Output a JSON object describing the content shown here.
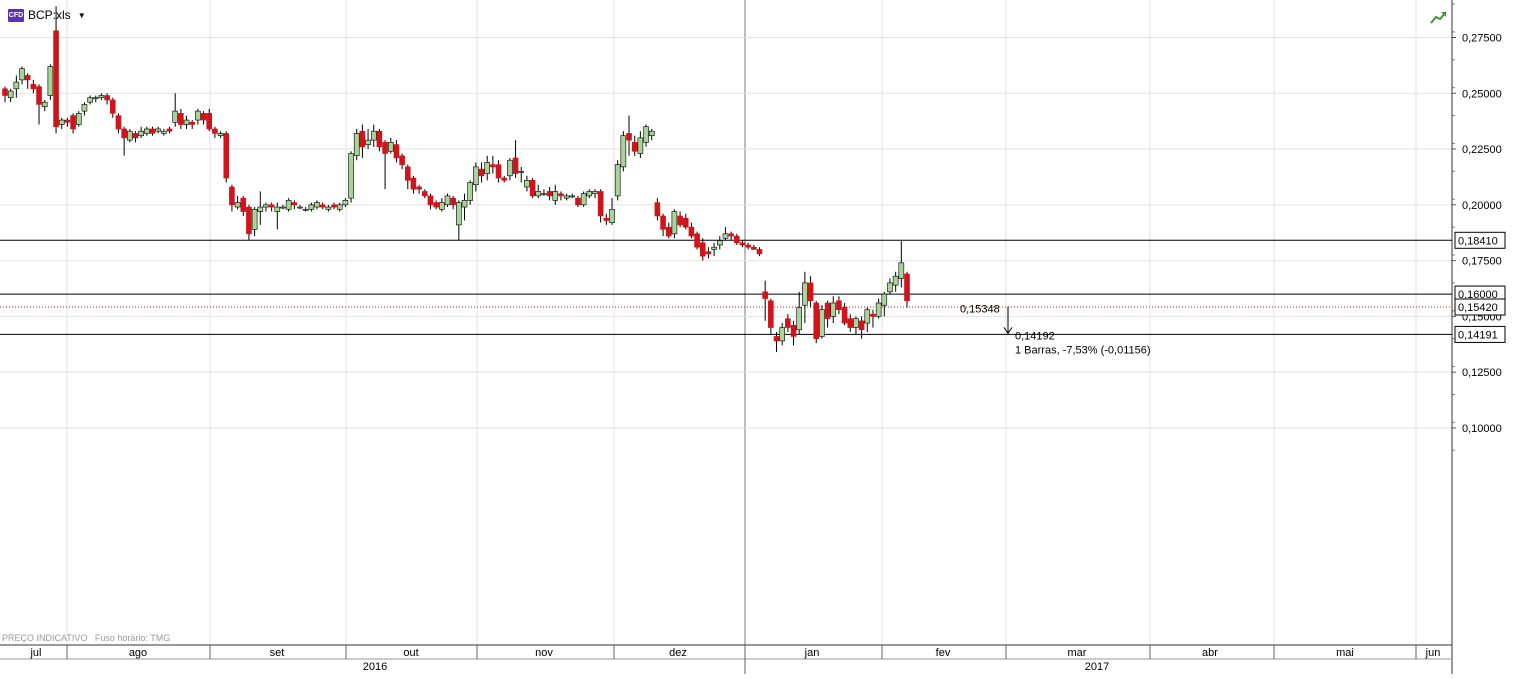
{
  "symbol": {
    "badge": "CFD",
    "name": "BCP:xls"
  },
  "footer": {
    "price_note": "PREÇO INDICATIVO",
    "timezone_note": "Fuso horário: TMG"
  },
  "colors": {
    "up": "#a8d49a",
    "down": "#d0141b",
    "grid": "#e2e2e2"
  },
  "chart_data": {
    "type": "candlestick",
    "title": "BCP:xls",
    "price_axis": {
      "ticks": [
        "0,27500",
        "0,25000",
        "0,22500",
        "0,20000",
        "0,17500",
        "0,15000",
        "0,12500",
        "0,10000"
      ],
      "range": [
        0.085,
        0.292
      ]
    },
    "time_axis": {
      "months": [
        "jul",
        "ago",
        "set",
        "out",
        "nov",
        "dez",
        "jan",
        "fev",
        "mar",
        "abr",
        "mai",
        "jun"
      ],
      "years": [
        "2016",
        "2017"
      ]
    },
    "horizontal_lines": [
      {
        "value": 0.1841,
        "label": "0,18410"
      },
      {
        "value": 0.16,
        "label": "0,16000"
      },
      {
        "value": 0.14191,
        "label": "0,14191"
      }
    ],
    "last_price": {
      "value": 0.1542,
      "label": "0,15420"
    },
    "measure": {
      "start_label": "0,15348",
      "end_label": "0,14192",
      "summary": "1 Barras, -7,53% (-0,01156)",
      "start_value": 0.15348,
      "end_value": 0.14192
    },
    "candles": [
      [
        0.252,
        0.249,
        0.246,
        0.253
      ],
      [
        0.248,
        0.251,
        0.246,
        0.252
      ],
      [
        0.252,
        0.255,
        0.248,
        0.258
      ],
      [
        0.256,
        0.261,
        0.254,
        0.262
      ],
      [
        0.258,
        0.256,
        0.252,
        0.259
      ],
      [
        0.254,
        0.252,
        0.25,
        0.256
      ],
      [
        0.253,
        0.245,
        0.236,
        0.254
      ],
      [
        0.244,
        0.246,
        0.242,
        0.247
      ],
      [
        0.249,
        0.262,
        0.247,
        0.263
      ],
      [
        0.278,
        0.235,
        0.232,
        0.289
      ],
      [
        0.236,
        0.238,
        0.234,
        0.239
      ],
      [
        0.238,
        0.237,
        0.235,
        0.239
      ],
      [
        0.24,
        0.234,
        0.232,
        0.241
      ],
      [
        0.236,
        0.241,
        0.235,
        0.242
      ],
      [
        0.242,
        0.245,
        0.24,
        0.246
      ],
      [
        0.246,
        0.248,
        0.245,
        0.249
      ],
      [
        0.248,
        0.248,
        0.246,
        0.249
      ],
      [
        0.248,
        0.249,
        0.247,
        0.25
      ],
      [
        0.249,
        0.247,
        0.245,
        0.25
      ],
      [
        0.247,
        0.241,
        0.239,
        0.248
      ],
      [
        0.24,
        0.234,
        0.232,
        0.241
      ],
      [
        0.234,
        0.23,
        0.222,
        0.235
      ],
      [
        0.229,
        0.233,
        0.228,
        0.234
      ],
      [
        0.232,
        0.23,
        0.228,
        0.233
      ],
      [
        0.231,
        0.233,
        0.23,
        0.235
      ],
      [
        0.232,
        0.234,
        0.231,
        0.235
      ],
      [
        0.234,
        0.232,
        0.231,
        0.235
      ],
      [
        0.233,
        0.234,
        0.232,
        0.235
      ],
      [
        0.232,
        0.233,
        0.231,
        0.234
      ],
      [
        0.234,
        0.233,
        0.232,
        0.235
      ],
      [
        0.237,
        0.242,
        0.235,
        0.25
      ],
      [
        0.241,
        0.236,
        0.234,
        0.243
      ],
      [
        0.236,
        0.238,
        0.234,
        0.24
      ],
      [
        0.237,
        0.236,
        0.234,
        0.238
      ],
      [
        0.238,
        0.242,
        0.236,
        0.243
      ],
      [
        0.241,
        0.238,
        0.236,
        0.242
      ],
      [
        0.241,
        0.234,
        0.233,
        0.243
      ],
      [
        0.234,
        0.232,
        0.23,
        0.235
      ],
      [
        0.231,
        0.232,
        0.23,
        0.233
      ],
      [
        0.232,
        0.212,
        0.21,
        0.233
      ],
      [
        0.208,
        0.2,
        0.197,
        0.209
      ],
      [
        0.199,
        0.201,
        0.198,
        0.204
      ],
      [
        0.203,
        0.197,
        0.195,
        0.204
      ],
      [
        0.199,
        0.187,
        0.184,
        0.2
      ],
      [
        0.189,
        0.198,
        0.186,
        0.199
      ],
      [
        0.197,
        0.199,
        0.191,
        0.206
      ],
      [
        0.199,
        0.2,
        0.197,
        0.201
      ],
      [
        0.2,
        0.199,
        0.197,
        0.201
      ],
      [
        0.197,
        0.199,
        0.189,
        0.201
      ],
      [
        0.199,
        0.199,
        0.198,
        0.2
      ],
      [
        0.198,
        0.202,
        0.197,
        0.203
      ],
      [
        0.201,
        0.2,
        0.198,
        0.202
      ],
      [
        0.199,
        0.199,
        0.198,
        0.2
      ],
      [
        0.198,
        0.198,
        0.197,
        0.199
      ],
      [
        0.198,
        0.2,
        0.197,
        0.201
      ],
      [
        0.199,
        0.201,
        0.198,
        0.202
      ],
      [
        0.2,
        0.199,
        0.198,
        0.201
      ],
      [
        0.198,
        0.199,
        0.197,
        0.2
      ],
      [
        0.2,
        0.199,
        0.198,
        0.201
      ],
      [
        0.198,
        0.2,
        0.197,
        0.201
      ],
      [
        0.2,
        0.202,
        0.199,
        0.203
      ],
      [
        0.203,
        0.223,
        0.201,
        0.224
      ],
      [
        0.222,
        0.232,
        0.22,
        0.234
      ],
      [
        0.233,
        0.226,
        0.221,
        0.236
      ],
      [
        0.227,
        0.229,
        0.225,
        0.234
      ],
      [
        0.229,
        0.233,
        0.226,
        0.236
      ],
      [
        0.233,
        0.226,
        0.224,
        0.234
      ],
      [
        0.228,
        0.223,
        0.207,
        0.229
      ],
      [
        0.224,
        0.228,
        0.223,
        0.23
      ],
      [
        0.227,
        0.221,
        0.219,
        0.229
      ],
      [
        0.222,
        0.218,
        0.216,
        0.223
      ],
      [
        0.217,
        0.211,
        0.207,
        0.218
      ],
      [
        0.212,
        0.207,
        0.205,
        0.213
      ],
      [
        0.208,
        0.207,
        0.205,
        0.209
      ],
      [
        0.206,
        0.204,
        0.203,
        0.207
      ],
      [
        0.204,
        0.2,
        0.198,
        0.205
      ],
      [
        0.201,
        0.199,
        0.198,
        0.202
      ],
      [
        0.198,
        0.201,
        0.197,
        0.203
      ],
      [
        0.2,
        0.204,
        0.199,
        0.205
      ],
      [
        0.203,
        0.2,
        0.198,
        0.204
      ],
      [
        0.191,
        0.201,
        0.184,
        0.202
      ],
      [
        0.199,
        0.202,
        0.193,
        0.205
      ],
      [
        0.202,
        0.21,
        0.2,
        0.211
      ],
      [
        0.209,
        0.217,
        0.206,
        0.219
      ],
      [
        0.216,
        0.213,
        0.21,
        0.219
      ],
      [
        0.214,
        0.219,
        0.211,
        0.222
      ],
      [
        0.218,
        0.217,
        0.214,
        0.222
      ],
      [
        0.218,
        0.212,
        0.21,
        0.22
      ],
      [
        0.212,
        0.211,
        0.21,
        0.213
      ],
      [
        0.213,
        0.22,
        0.211,
        0.221
      ],
      [
        0.221,
        0.214,
        0.212,
        0.229
      ],
      [
        0.215,
        0.215,
        0.21,
        0.217
      ],
      [
        0.208,
        0.211,
        0.206,
        0.213
      ],
      [
        0.211,
        0.204,
        0.203,
        0.212
      ],
      [
        0.204,
        0.206,
        0.203,
        0.209
      ],
      [
        0.205,
        0.205,
        0.204,
        0.207
      ],
      [
        0.206,
        0.204,
        0.202,
        0.208
      ],
      [
        0.202,
        0.206,
        0.2,
        0.209
      ],
      [
        0.205,
        0.204,
        0.202,
        0.206
      ],
      [
        0.203,
        0.204,
        0.202,
        0.205
      ],
      [
        0.204,
        0.204,
        0.203,
        0.205
      ],
      [
        0.203,
        0.2,
        0.199,
        0.204
      ],
      [
        0.2,
        0.205,
        0.199,
        0.206
      ],
      [
        0.204,
        0.206,
        0.203,
        0.207
      ],
      [
        0.205,
        0.206,
        0.203,
        0.207
      ],
      [
        0.206,
        0.195,
        0.192,
        0.207
      ],
      [
        0.194,
        0.193,
        0.191,
        0.196
      ],
      [
        0.192,
        0.198,
        0.191,
        0.203
      ],
      [
        0.204,
        0.218,
        0.202,
        0.22
      ],
      [
        0.217,
        0.231,
        0.215,
        0.233
      ],
      [
        0.232,
        0.229,
        0.222,
        0.24
      ],
      [
        0.228,
        0.224,
        0.222,
        0.231
      ],
      [
        0.223,
        0.23,
        0.221,
        0.233
      ],
      [
        0.228,
        0.235,
        0.226,
        0.236
      ],
      [
        0.231,
        0.233,
        0.229,
        0.234
      ],
      [
        0.201,
        0.195,
        0.193,
        0.203
      ],
      [
        0.195,
        0.189,
        0.186,
        0.196
      ],
      [
        0.19,
        0.186,
        0.185,
        0.192
      ],
      [
        0.187,
        0.197,
        0.185,
        0.198
      ],
      [
        0.195,
        0.191,
        0.19,
        0.197
      ],
      [
        0.194,
        0.19,
        0.189,
        0.196
      ],
      [
        0.19,
        0.186,
        0.185,
        0.192
      ],
      [
        0.187,
        0.181,
        0.18,
        0.188
      ],
      [
        0.183,
        0.177,
        0.175,
        0.185
      ],
      [
        0.179,
        0.178,
        0.176,
        0.181
      ],
      [
        0.18,
        0.181,
        0.177,
        0.183
      ],
      [
        0.182,
        0.184,
        0.18,
        0.186
      ],
      [
        0.185,
        0.187,
        0.184,
        0.19
      ],
      [
        0.187,
        0.186,
        0.184,
        0.188
      ],
      [
        0.186,
        0.183,
        0.182,
        0.187
      ],
      [
        0.183,
        0.182,
        0.181,
        0.184
      ],
      [
        0.182,
        0.181,
        0.18,
        0.183
      ],
      [
        0.181,
        0.18,
        0.18,
        0.182
      ],
      [
        0.18,
        0.178,
        0.177,
        0.181
      ],
      [
        0.161,
        0.158,
        0.148,
        0.166
      ],
      [
        0.157,
        0.145,
        0.142,
        0.158
      ],
      [
        0.141,
        0.139,
        0.134,
        0.143
      ],
      [
        0.139,
        0.145,
        0.137,
        0.147
      ],
      [
        0.149,
        0.145,
        0.143,
        0.151
      ],
      [
        0.146,
        0.141,
        0.137,
        0.148
      ],
      [
        0.144,
        0.154,
        0.142,
        0.161
      ],
      [
        0.155,
        0.165,
        0.147,
        0.17
      ],
      [
        0.165,
        0.157,
        0.154,
        0.168
      ],
      [
        0.156,
        0.14,
        0.138,
        0.157
      ],
      [
        0.141,
        0.153,
        0.14,
        0.155
      ],
      [
        0.156,
        0.149,
        0.145,
        0.157
      ],
      [
        0.15,
        0.156,
        0.147,
        0.159
      ],
      [
        0.157,
        0.153,
        0.151,
        0.159
      ],
      [
        0.154,
        0.147,
        0.146,
        0.156
      ],
      [
        0.149,
        0.145,
        0.143,
        0.151
      ],
      [
        0.145,
        0.149,
        0.142,
        0.15
      ],
      [
        0.148,
        0.144,
        0.14,
        0.15
      ],
      [
        0.147,
        0.153,
        0.143,
        0.154
      ],
      [
        0.151,
        0.15,
        0.145,
        0.153
      ],
      [
        0.15,
        0.156,
        0.149,
        0.158
      ],
      [
        0.155,
        0.16,
        0.15,
        0.161
      ],
      [
        0.161,
        0.165,
        0.16,
        0.167
      ],
      [
        0.164,
        0.168,
        0.161,
        0.17
      ],
      [
        0.167,
        0.174,
        0.163,
        0.184
      ],
      [
        0.169,
        0.157,
        0.154,
        0.17
      ]
    ]
  }
}
